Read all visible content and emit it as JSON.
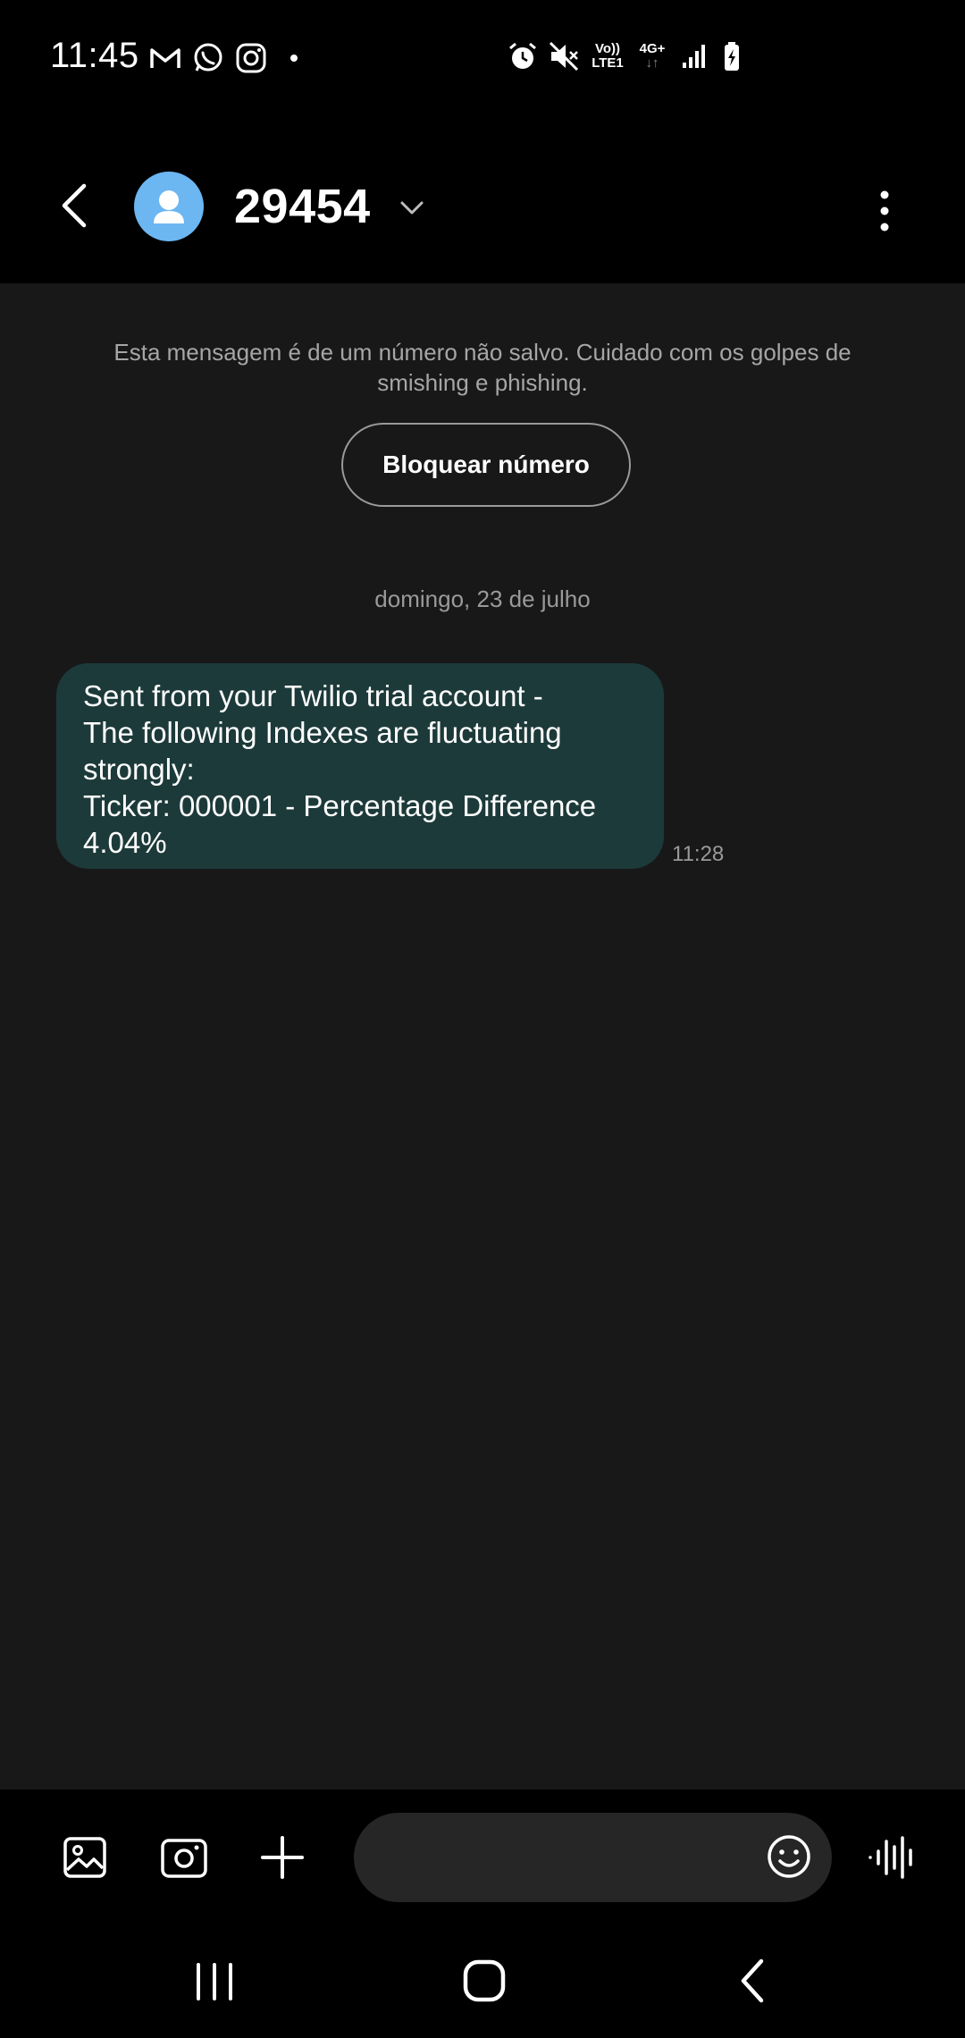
{
  "status_bar": {
    "time": "11:45",
    "left_icons": [
      "gmail-icon",
      "whatsapp-icon",
      "instagram-icon",
      "notification-dot-icon"
    ],
    "right_icons": [
      "alarm-icon",
      "mute-icon",
      "volte-icon",
      "4g-plus-icon",
      "signal-icon",
      "battery-charging-icon"
    ],
    "volte_top": "Vo))",
    "volte_bottom": "LTE1",
    "network_label": "4G+"
  },
  "header": {
    "contact_name": "29454",
    "avatar_icon": "person-icon",
    "avatar_color": "#6cb6f2"
  },
  "conversation": {
    "warning": "Esta mensagem é de um número não salvo. Cuidado com os golpes de smishing e phishing.",
    "block_button": "Bloquear número",
    "date_separator": "domingo, 23 de julho",
    "messages": [
      {
        "text": "Sent from your Twilio trial account -\nThe following Indexes are fluctuating strongly:\nTicker: 000001 - Percentage Difference 4.04%",
        "time": "11:28",
        "bubble_color": "#1d3a3a"
      }
    ]
  },
  "composer": {
    "icons": [
      "gallery-icon",
      "camera-icon",
      "plus-icon",
      "emoji-icon",
      "voice-icon"
    ]
  },
  "nav_bar": {
    "icons": [
      "recents-icon",
      "home-icon",
      "back-icon"
    ]
  },
  "colors": {
    "background": "#181818",
    "top_bar": "#000000",
    "accent": "#6cb6f2"
  }
}
